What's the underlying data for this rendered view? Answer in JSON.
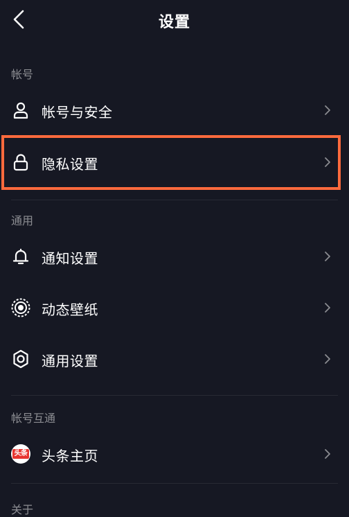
{
  "header": {
    "title": "设置",
    "back_icon": "chevron-left-icon"
  },
  "sections": [
    {
      "header": "帐号",
      "items": [
        {
          "label": "帐号与安全",
          "icon": "person-icon"
        },
        {
          "label": "隐私设置",
          "icon": "lock-icon",
          "highlighted": true
        }
      ]
    },
    {
      "header": "通用",
      "items": [
        {
          "label": "通知设置",
          "icon": "bell-icon"
        },
        {
          "label": "动态壁纸",
          "icon": "live-wallpaper-icon"
        },
        {
          "label": "通用设置",
          "icon": "gear-icon"
        }
      ]
    },
    {
      "header": "帐号互通",
      "items": [
        {
          "label": "头条主页",
          "icon": "toutiao-logo-icon",
          "icon_text": "头条"
        }
      ]
    },
    {
      "header": "关于"
    }
  ],
  "colors": {
    "background": "#161823",
    "highlight_border": "#ff6a3d",
    "toutiao_red": "#e8342f"
  }
}
